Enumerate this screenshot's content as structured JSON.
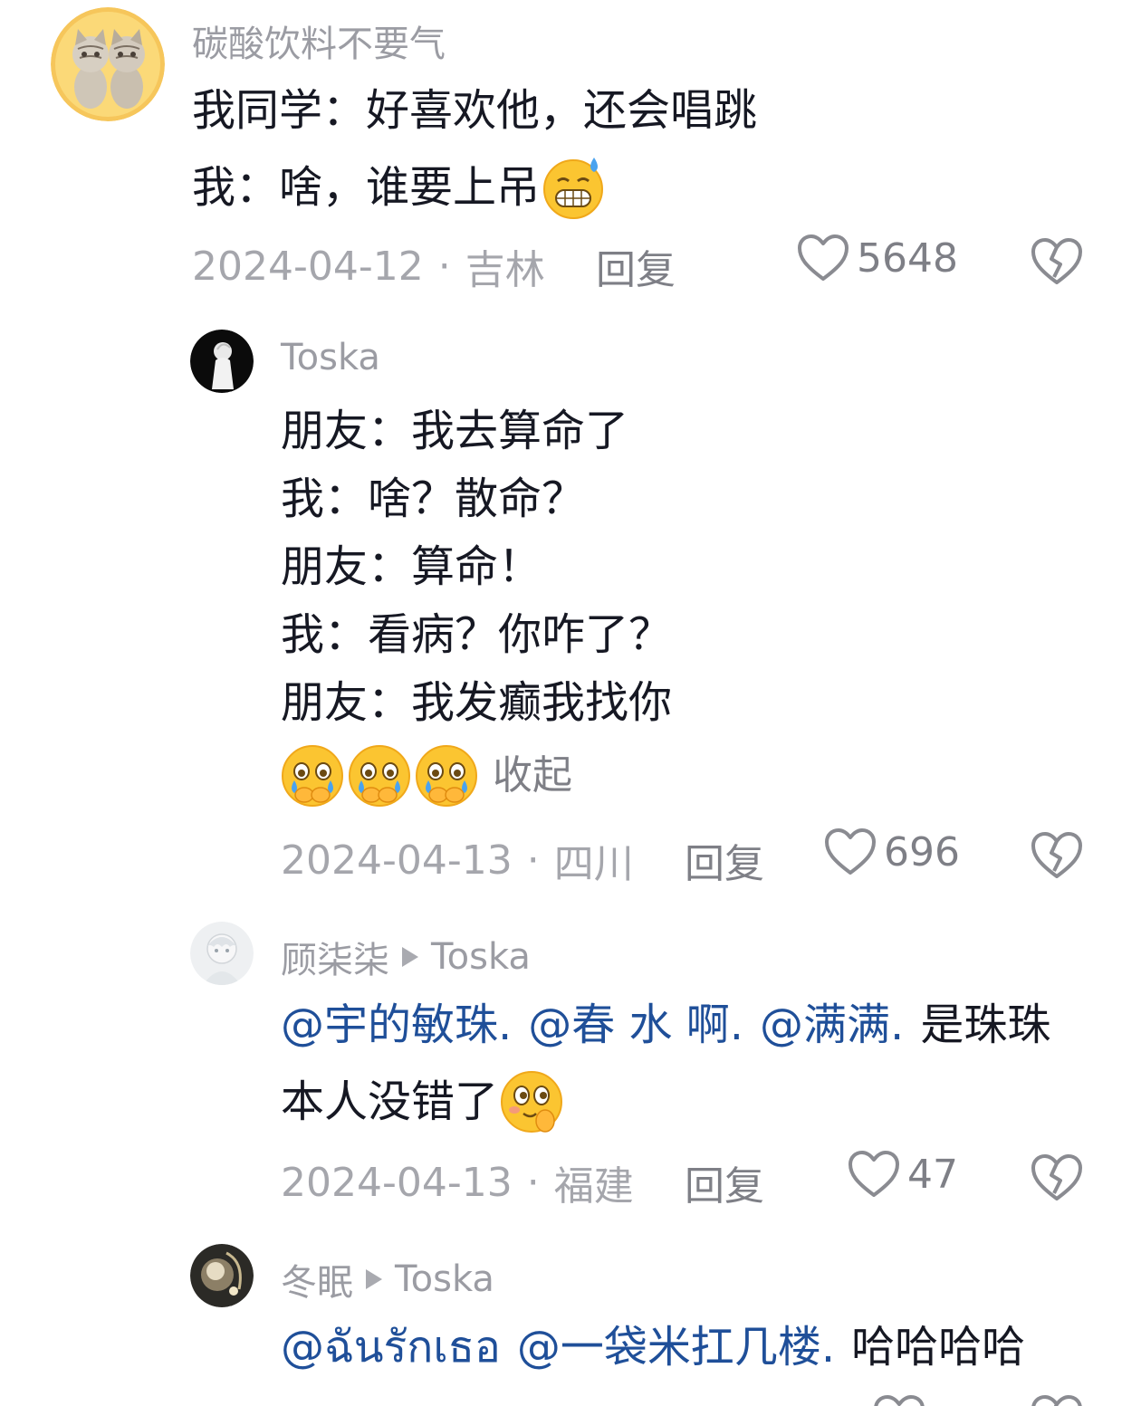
{
  "comments": [
    {
      "user": "碳酸饮料不要气",
      "lines": [
        "我同学：好喜欢他，还会唱跳",
        "我：啥，谁要上吊"
      ],
      "date": "2024-04-12",
      "location": "吉林",
      "reply_label": "回复",
      "likes": "5648"
    },
    {
      "user": "Toska",
      "lines": [
        "朋友：我去算命了",
        "我：啥？散命？",
        "朋友：算命！",
        "我：看病？你咋了？",
        "朋友：我发癫我找你"
      ],
      "collapse_label": "收起",
      "date": "2024-04-13",
      "location": "四川",
      "reply_label": "回复",
      "likes": "696"
    },
    {
      "user": "顾柒柒",
      "reply_to": "Toska",
      "mentions": [
        "@宇的敏珠.",
        "@春 水 啊.",
        "@满满."
      ],
      "line1_tail": "是珠珠",
      "line2": "本人没错了",
      "date": "2024-04-13",
      "location": "福建",
      "reply_label": "回复",
      "likes": "47"
    },
    {
      "user": "冬眠",
      "reply_to": "Toska",
      "mentions": [
        "@ฉันรักเธอ",
        "@一袋米扛几楼."
      ],
      "line1_tail": "哈哈哈哈"
    }
  ]
}
